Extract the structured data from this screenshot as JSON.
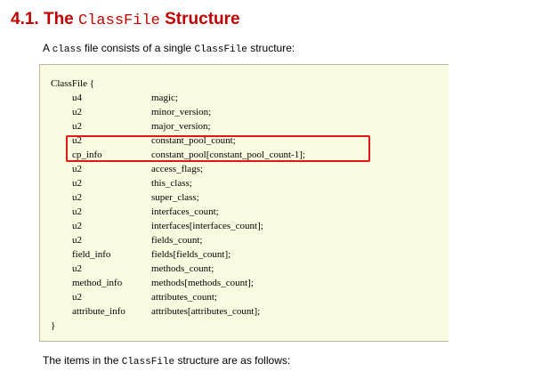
{
  "heading": {
    "number": "4.1. The ",
    "code": "ClassFile",
    "suffix": " Structure"
  },
  "intro": {
    "prefix": "A ",
    "code1": "class",
    "middle": " file consists of a single ",
    "code2": "ClassFile",
    "suffix": " structure:"
  },
  "code_block": {
    "open": "ClassFile {",
    "close": "}",
    "fields": [
      {
        "type": "u4",
        "name": "magic;"
      },
      {
        "type": "u2",
        "name": "minor_version;"
      },
      {
        "type": "u2",
        "name": "major_version;"
      },
      {
        "type": "u2",
        "name": "constant_pool_count;"
      },
      {
        "type": "cp_info",
        "name": "constant_pool[constant_pool_count-1];"
      },
      {
        "type": "u2",
        "name": "access_flags;"
      },
      {
        "type": "u2",
        "name": "this_class;"
      },
      {
        "type": "u2",
        "name": "super_class;"
      },
      {
        "type": "u2",
        "name": "interfaces_count;"
      },
      {
        "type": "u2",
        "name": "interfaces[interfaces_count];"
      },
      {
        "type": "u2",
        "name": "fields_count;"
      },
      {
        "type": "field_info",
        "name": "fields[fields_count];"
      },
      {
        "type": "u2",
        "name": "methods_count;"
      },
      {
        "type": "method_info",
        "name": "methods[methods_count];"
      },
      {
        "type": "u2",
        "name": "attributes_count;"
      },
      {
        "type": "attribute_info",
        "name": "attributes[attributes_count];"
      }
    ]
  },
  "outro": {
    "prefix": "The items in the ",
    "code": "ClassFile",
    "suffix": " structure are as follows:"
  },
  "colors": {
    "heading": "#c00000",
    "code_background": "#fbfbe2",
    "highlight_border": "#e01818"
  }
}
